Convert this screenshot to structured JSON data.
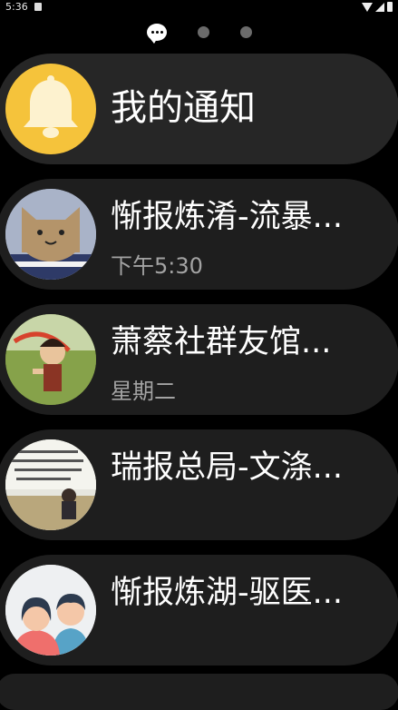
{
  "status_bar": {
    "time": "5:36"
  },
  "pager": {
    "active_page": 1,
    "page_count": 3
  },
  "header": {
    "title": "我的通知",
    "icon": "bell-icon"
  },
  "notifications": [
    {
      "title": "惭报炼淆-流暴...",
      "subtitle": "下午5:30",
      "avatar": "cat-avatar"
    },
    {
      "title": "萧蔡社群友馆...",
      "subtitle": "星期二",
      "avatar": "game-character-avatar"
    },
    {
      "title": "瑞报总局-文涤...",
      "subtitle": "",
      "avatar": "classroom-photo-avatar"
    },
    {
      "title": "惭报炼湖-驱医...",
      "subtitle": "",
      "avatar": "people-avatar"
    }
  ],
  "colors": {
    "background": "#000000",
    "card": "#1e1e1e",
    "header_card": "#262626",
    "bell_circle": "#f5c33b",
    "subtitle": "#a3a3a3"
  }
}
